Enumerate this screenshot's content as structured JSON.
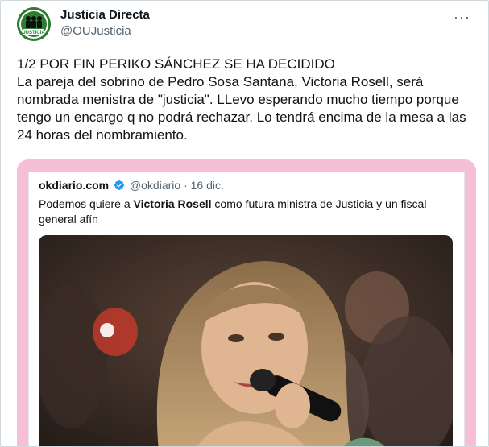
{
  "account": {
    "display_name": "Justicia Directa",
    "handle": "@OUJusticia",
    "avatar_text": "JUSTICIA"
  },
  "more_label": "···",
  "tweet": {
    "text": "1/2 POR FIN PERIKO SÁNCHEZ SE HA DECIDIDO\nLa pareja del sobrino de Pedro Sosa Santana, Victoria Rosell, será nombrada menistra de \"justicia\". LLevo esperando mucho tiempo porque tengo un encargo q no podrá rechazar. Lo tendrá encima de la mesa a las 24 horas del nombramiento."
  },
  "quoted": {
    "source_name": "okdiario.com",
    "source_handle": "@okdiario",
    "separator": "·",
    "date": "16 dic.",
    "text_before": "Podemos quiere a ",
    "text_bold": "Victoria Rosell",
    "text_after": " como futura ministra de Justicia y un fiscal general afín"
  },
  "colors": {
    "card_border": "#f7bfd6",
    "verified": "#1d9bf0",
    "avatar_bg": "#2e7d32"
  }
}
